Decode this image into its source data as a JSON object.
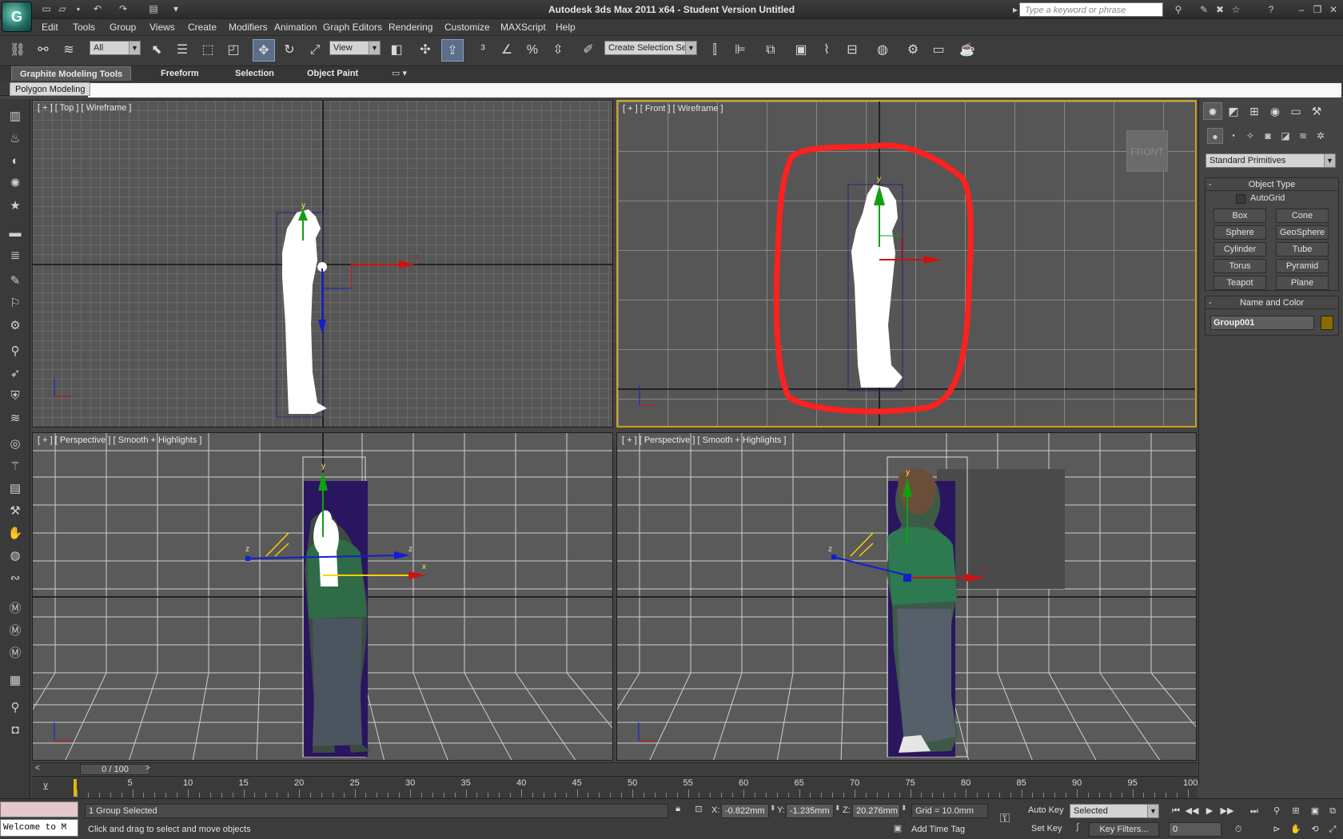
{
  "app": {
    "window_title": "Autodesk 3ds Max  2011 x64  - Student Version   Untitled",
    "search_placeholder": "Type a keyword or phrase",
    "logo_letter": "G"
  },
  "menu": [
    "Edit",
    "Tools",
    "Group",
    "Views",
    "Create",
    "Modifiers",
    "Animation",
    "Graph Editors",
    "Rendering",
    "Customize",
    "MAXScript",
    "Help"
  ],
  "toolbar": {
    "selection_filter": "All",
    "reference_coord": "View",
    "named_selection_placeholder": "Create Selection Se"
  },
  "ribbon": {
    "tabs": [
      "Graphite Modeling Tools",
      "Freeform",
      "Selection",
      "Object Paint"
    ],
    "active_tab": 0,
    "panel_button": "Polygon Modeling"
  },
  "viewports": {
    "top_left_label": "[ + ] [ Top ] [ Wireframe ]",
    "top_right_label": "[ + ] [ Front ] [ Wireframe ]",
    "bottom_left_label": "[ + ] [ Perspective ] [ Smooth + Highlights ]",
    "bottom_right_label": "[ + ] [ Perspective ] [ Smooth + Highlights ]",
    "viewcube_label": "FRONT",
    "axis_x": "x",
    "axis_y": "y",
    "axis_z": "z"
  },
  "command_panel": {
    "category_dropdown": "Standard Primitives",
    "object_type_header": "Object Type",
    "autogrid_label": "AutoGrid",
    "object_buttons": [
      "Box",
      "Cone",
      "Sphere",
      "GeoSphere",
      "Cylinder",
      "Tube",
      "Torus",
      "Pyramid",
      "Teapot",
      "Plane"
    ],
    "name_color_header": "Name and Color",
    "object_name": "Group001",
    "object_color": "#8a6a00"
  },
  "timeline": {
    "frame_counter": "0 / 100",
    "ticks": [
      "5",
      "10",
      "15",
      "20",
      "25",
      "30",
      "35",
      "40",
      "45",
      "50",
      "55",
      "60",
      "65",
      "70",
      "75",
      "80",
      "85",
      "90",
      "95",
      "100"
    ]
  },
  "status": {
    "selection_status": "1 Group Selected",
    "prompt": "Click and drag to select and move objects",
    "maxscript_listener": "Welcome to M",
    "x_label": "X:",
    "x_value": "-0.822mm",
    "y_label": "Y:",
    "y_value": "-1.235mm",
    "z_label": "Z:",
    "z_value": "20.276mm",
    "grid": "Grid = 10.0mm",
    "add_time_tag": "Add Time Tag",
    "auto_key": "Auto Key",
    "set_key": "Set Key",
    "key_mode": "Selected",
    "key_filters": "Key Filters...",
    "current_frame": "0"
  },
  "colors": {
    "annotation_red": "#ff2020",
    "axis_red": "#d01010",
    "axis_green": "#10a010",
    "axis_blue": "#1020d0",
    "active_viewport_border": "#c8a020",
    "bbox_purple": "#3a1a7a"
  }
}
